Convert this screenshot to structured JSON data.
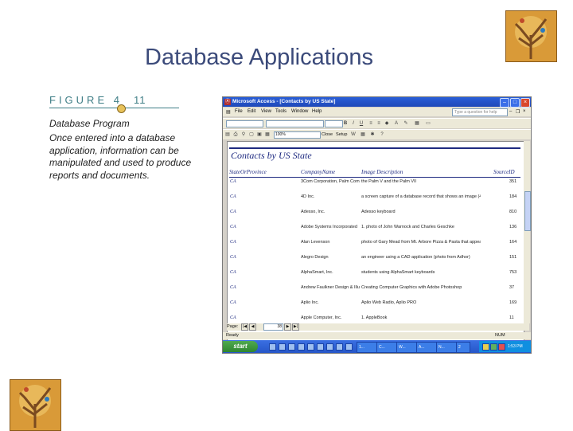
{
  "slide": {
    "title": "Database Applications"
  },
  "figure": {
    "label": "FIGURE 4",
    "number": "11",
    "caption_title": "Database Program",
    "caption_body": "Once entered into a database application, information can be manipulated and used to produce reports and documents."
  },
  "window": {
    "title": "Microsoft Access - [Contacts by US State]",
    "app_icon": "access-icon",
    "menu": [
      "File",
      "Edit",
      "View",
      "Tools",
      "Window",
      "Help"
    ],
    "help_placeholder": "Type a question for help",
    "zoom": "100%",
    "close_label": "Close",
    "setup_label": "Setup"
  },
  "report": {
    "title": "Contacts by US State",
    "columns": [
      "StateOrProvince",
      "CompanyName",
      "Image Description",
      "SourceID"
    ],
    "rows": [
      [
        "CA",
        "3Com Corporation, Palm Compu",
        "the Palm V and the Palm VII",
        "351"
      ],
      [
        "CA",
        "4D Inc.",
        "a screen capture of a database record that shows an image (4th",
        "184"
      ],
      [
        "CA",
        "Adesso, Inc.",
        "Adesso keyboard",
        "810"
      ],
      [
        "CA",
        "Adobe Systems Incorporated",
        "1. photo of John Warnock and Charles Geschke",
        "136"
      ],
      [
        "CA",
        "Alan Levenson",
        "photo of Gary Mead from Mt. Arbore Pizza & Pasta that appeared i",
        "164"
      ],
      [
        "CA",
        "Alegro Design",
        "an engineer using a CAD application (photo from Adhor)",
        "151"
      ],
      [
        "CA",
        "AlphaSmart, Inc.",
        "students using AlphaSmart keyboards",
        "753"
      ],
      [
        "CA",
        "Andrew Faulkner Design & Illustr",
        "Creating Computer Graphics with Adobe Photoshop",
        "37"
      ],
      [
        "CA",
        "Aplio Inc.",
        "Aplio Web Radio, Aplio PRO",
        "169"
      ],
      [
        "CA",
        "Apple Computer, Inc.",
        "1. AppleBook",
        "11"
      ]
    ]
  },
  "navigation": {
    "page_label": "Page:",
    "page_number": "38"
  },
  "status": {
    "left": "Ready",
    "right": "NUM"
  },
  "taskbar": {
    "start_label": "start",
    "clock": "1:53 PM",
    "buttons": [
      "1...",
      "C...",
      "W...",
      "A...",
      "N...",
      "2"
    ]
  }
}
